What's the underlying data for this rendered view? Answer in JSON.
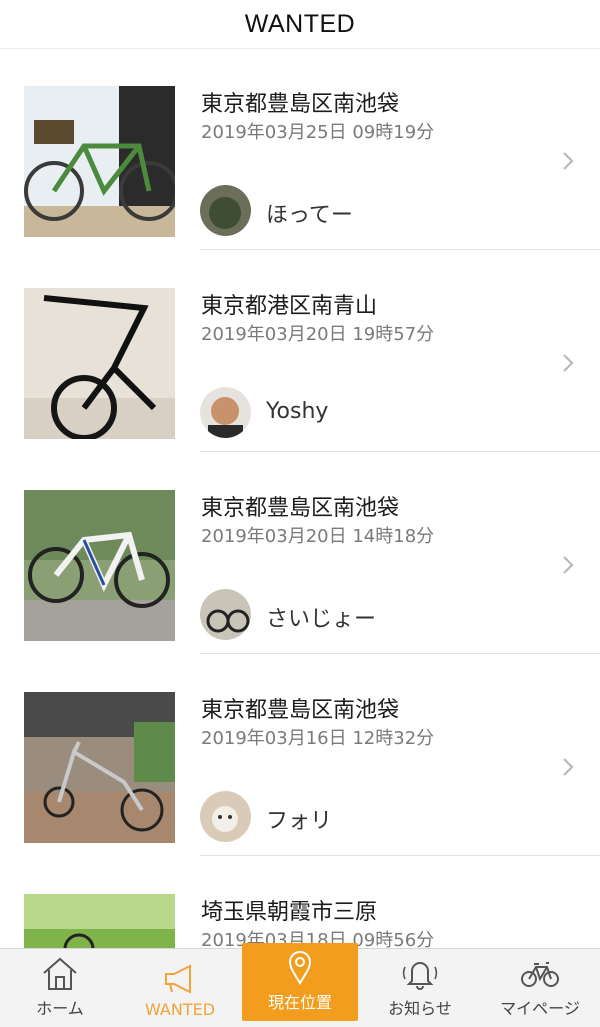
{
  "header": {
    "title": "WANTED"
  },
  "items": [
    {
      "place": "東京都豊島区南池袋",
      "datetime": "2019年03月25日 09時19分",
      "user": "ほってー"
    },
    {
      "place": "東京都港区南青山",
      "datetime": "2019年03月20日 19時57分",
      "user": "Yoshy"
    },
    {
      "place": "東京都豊島区南池袋",
      "datetime": "2019年03月20日 14時18分",
      "user": "さいじょー"
    },
    {
      "place": "東京都豊島区南池袋",
      "datetime": "2019年03月16日 12時32分",
      "user": "フォリ"
    },
    {
      "place": "埼玉県朝霞市三原",
      "datetime": "2019年03月18日 09時56分",
      "user": ""
    }
  ],
  "tabbar": {
    "home": "ホーム",
    "wanted": "WANTED",
    "location": "現在位置",
    "notifications": "お知らせ",
    "mypage": "マイページ"
  },
  "colors": {
    "accent": "#f29d1d",
    "active_text": "#f2a33a"
  },
  "icons": [
    "chevron-right-icon",
    "home-icon",
    "megaphone-icon",
    "map-pin-icon",
    "bell-icon",
    "bicycle-icon"
  ]
}
